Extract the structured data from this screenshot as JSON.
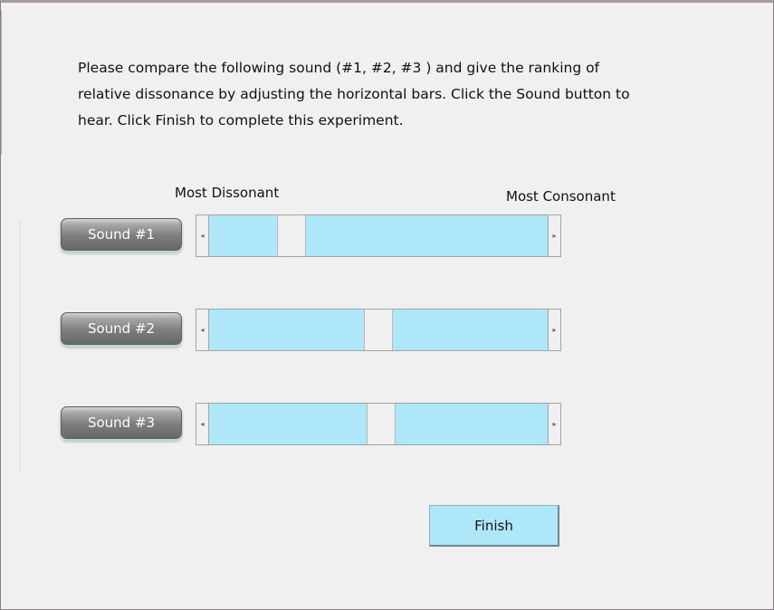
{
  "instructions": "Please compare the following sound (#1, #2, #3 ) and give the ranking of relative dissonance by adjusting the horizontal bars. Click the Sound button to hear. Click Finish to complete this experiment.",
  "scale": {
    "left_label": "Most Dissonant",
    "right_label": "Most Consonant"
  },
  "sounds": [
    {
      "button_label": "Sound #1",
      "slider_value_fraction": 0.22
    },
    {
      "button_label": "Sound #2",
      "slider_value_fraction": 0.5
    },
    {
      "button_label": "Sound #3",
      "slider_value_fraction": 0.51
    }
  ],
  "finish_label": "Finish",
  "colors": {
    "background": "#f0f0f0",
    "accent": "#aee8f8",
    "button_gray": "#7d7d7d"
  },
  "icons": {
    "scroll_left": "◂",
    "scroll_right": "▸"
  }
}
